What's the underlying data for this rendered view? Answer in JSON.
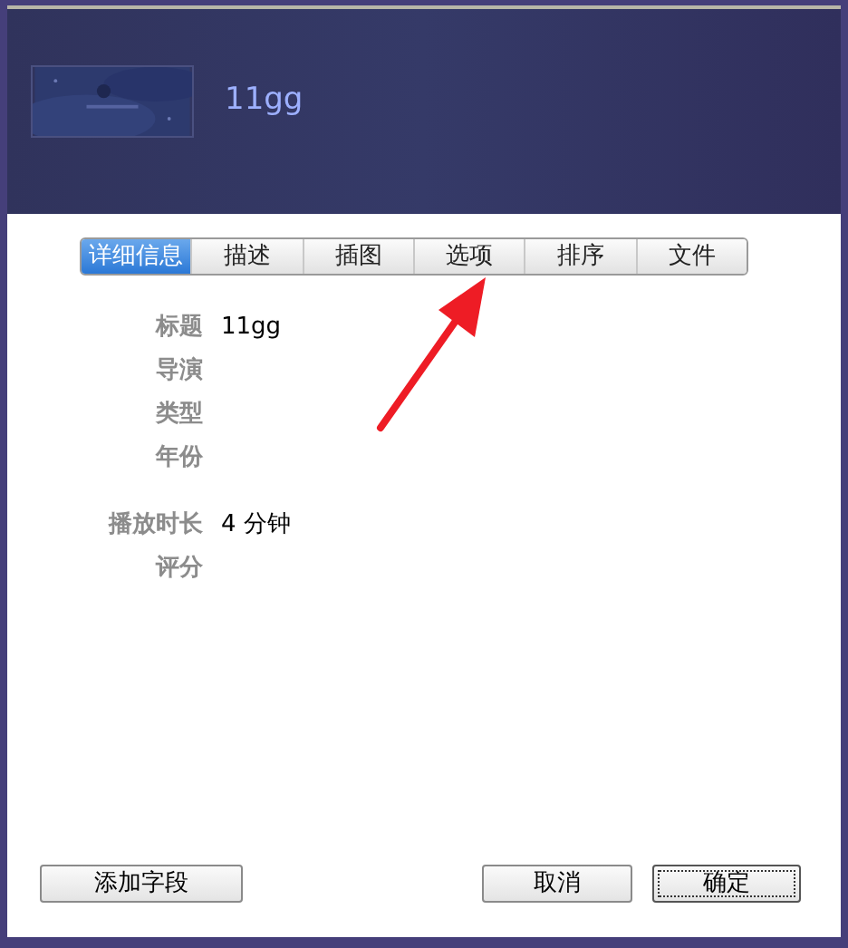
{
  "header": {
    "title": "11gg"
  },
  "tabs": [
    {
      "label": "详细信息",
      "selected": true
    },
    {
      "label": "描述",
      "selected": false
    },
    {
      "label": "插图",
      "selected": false
    },
    {
      "label": "选项",
      "selected": false
    },
    {
      "label": "排序",
      "selected": false
    },
    {
      "label": "文件",
      "selected": false
    }
  ],
  "field_groups": [
    [
      {
        "label": "标题",
        "value": "11gg"
      },
      {
        "label": "导演"
      },
      {
        "label": "类型"
      },
      {
        "label": "年份"
      }
    ],
    [
      {
        "label": "播放时长",
        "value": "4 分钟"
      },
      {
        "label": "评分"
      }
    ]
  ],
  "buttons": {
    "add_field": "添加字段",
    "cancel": "取消",
    "ok": "确定"
  }
}
